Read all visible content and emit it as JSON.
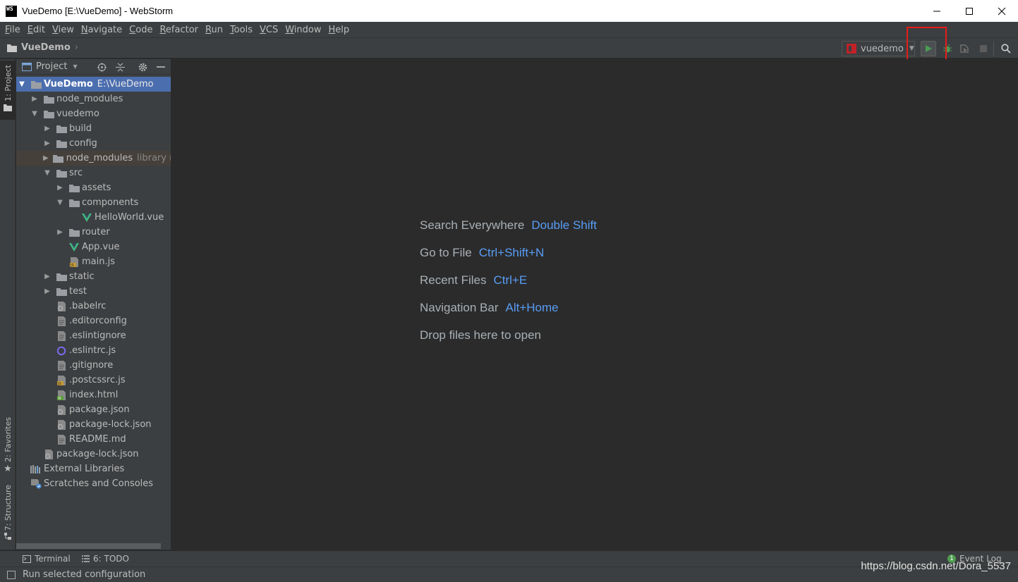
{
  "window": {
    "app_logo": "WS",
    "title": "VueDemo [E:\\VueDemo] - WebStorm",
    "controls": [
      "minimize-icon",
      "maximize-icon",
      "close-icon"
    ]
  },
  "menu": [
    "File",
    "Edit",
    "View",
    "Navigate",
    "Code",
    "Refactor",
    "Run",
    "Tools",
    "VCS",
    "Window",
    "Help"
  ],
  "navbar": {
    "breadcrumb": "VueDemo",
    "run_config": "vuedemo",
    "toolbar_icons": [
      "run-icon",
      "debug-icon",
      "coverage-icon",
      "stop-icon",
      "search-icon"
    ]
  },
  "left_stripe": {
    "project_tab": "1: Project",
    "favorites_tab": "2: Favorites",
    "structure_tab": "7: Structure"
  },
  "project_panel": {
    "title": "Project",
    "tree": [
      {
        "label": "VueDemo",
        "hint": "E:\\VueDemo",
        "icon": "folder-icon",
        "arrow": "down",
        "level": 0,
        "selected": true
      },
      {
        "label": "node_modules",
        "icon": "folder-icon",
        "arrow": "right",
        "level": 1
      },
      {
        "label": "vuedemo",
        "icon": "folder-icon",
        "arrow": "down",
        "level": 1
      },
      {
        "label": "build",
        "icon": "folder-icon",
        "arrow": "right",
        "level": 2
      },
      {
        "label": "config",
        "icon": "folder-icon",
        "arrow": "right",
        "level": 2
      },
      {
        "label": "node_modules",
        "hint": "library ro",
        "icon": "folder-icon",
        "arrow": "right",
        "level": 2,
        "excluded": true
      },
      {
        "label": "src",
        "icon": "folder-icon",
        "arrow": "down",
        "level": 2
      },
      {
        "label": "assets",
        "icon": "folder-icon",
        "arrow": "right",
        "level": 3
      },
      {
        "label": "components",
        "icon": "folder-icon",
        "arrow": "down",
        "level": 3
      },
      {
        "label": "HelloWorld.vue",
        "icon": "vue-file-icon",
        "arrow": "",
        "level": 4
      },
      {
        "label": "router",
        "icon": "folder-icon",
        "arrow": "right",
        "level": 3
      },
      {
        "label": "App.vue",
        "icon": "vue-file-icon",
        "arrow": "",
        "level": 3
      },
      {
        "label": "main.js",
        "icon": "js-file-icon",
        "arrow": "",
        "level": 3
      },
      {
        "label": "static",
        "icon": "folder-icon",
        "arrow": "right",
        "level": 2
      },
      {
        "label": "test",
        "icon": "folder-icon",
        "arrow": "right",
        "level": 2
      },
      {
        "label": ".babelrc",
        "icon": "config-file-icon",
        "arrow": "",
        "level": 2
      },
      {
        "label": ".editorconfig",
        "icon": "text-file-icon",
        "arrow": "",
        "level": 2
      },
      {
        "label": ".eslintignore",
        "icon": "text-file-icon",
        "arrow": "",
        "level": 2
      },
      {
        "label": ".eslintrc.js",
        "icon": "eslint-file-icon",
        "arrow": "",
        "level": 2
      },
      {
        "label": ".gitignore",
        "icon": "text-file-icon",
        "arrow": "",
        "level": 2
      },
      {
        "label": ".postcssrc.js",
        "icon": "js-file-icon",
        "arrow": "",
        "level": 2
      },
      {
        "label": "index.html",
        "icon": "html-file-icon",
        "arrow": "",
        "level": 2
      },
      {
        "label": "package.json",
        "icon": "config-file-icon",
        "arrow": "",
        "level": 2
      },
      {
        "label": "package-lock.json",
        "icon": "config-file-icon",
        "arrow": "",
        "level": 2
      },
      {
        "label": "README.md",
        "icon": "text-file-icon",
        "arrow": "",
        "level": 2
      },
      {
        "label": "package-lock.json",
        "icon": "config-file-icon",
        "arrow": "",
        "level": 1
      },
      {
        "label": "External Libraries",
        "icon": "libraries-icon",
        "arrow": "",
        "level": 0
      },
      {
        "label": "Scratches and Consoles",
        "icon": "scratches-icon",
        "arrow": "",
        "level": 0
      }
    ]
  },
  "editor_hints": [
    {
      "text": "Search Everywhere",
      "key": "Double Shift"
    },
    {
      "text": "Go to File",
      "key": "Ctrl+Shift+N"
    },
    {
      "text": "Recent Files",
      "key": "Ctrl+E"
    },
    {
      "text": "Navigation Bar",
      "key": "Alt+Home"
    },
    {
      "text": "Drop files here to open",
      "key": ""
    }
  ],
  "bottom_tabs": {
    "terminal": "Terminal",
    "todo": "6: TODO",
    "event_log": "Event Log",
    "event_count": "1"
  },
  "status": {
    "message": "Run selected configuration",
    "watermark": "https://blog.csdn.net/Dora_5537"
  },
  "colors": {
    "accent_blue": "#589df6",
    "selection": "#4b6eaf",
    "highlight_box": "#e81b1b",
    "run_green": "#499c54"
  }
}
